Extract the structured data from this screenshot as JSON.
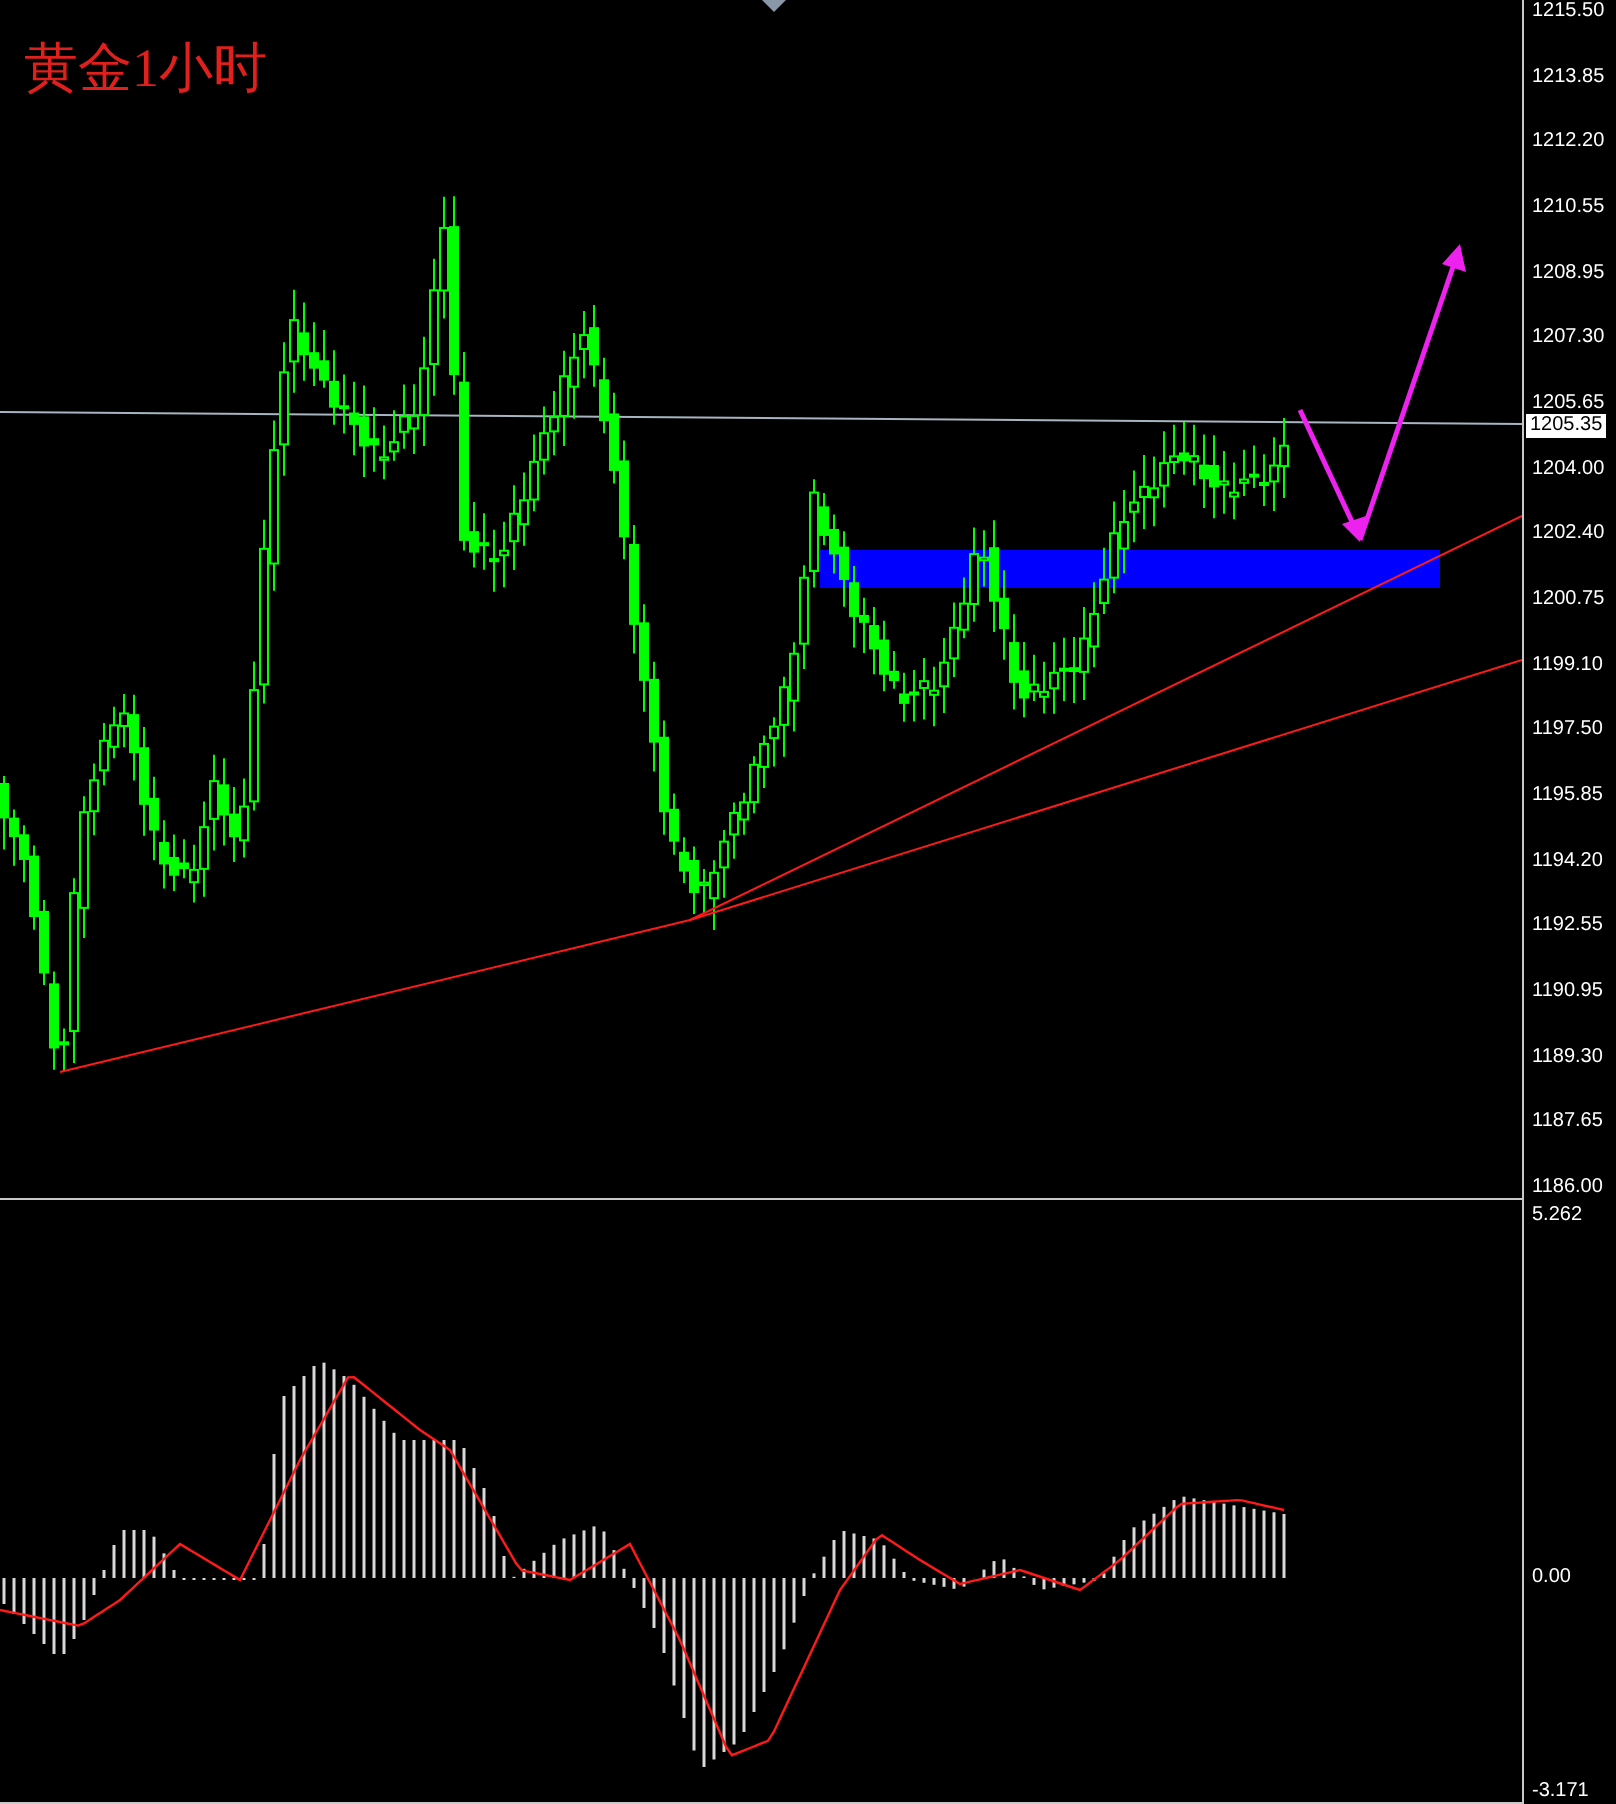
{
  "chart_title": "黄金1小时",
  "price_axis": {
    "labels": [
      "1215.50",
      "1213.85",
      "1212.20",
      "1210.55",
      "1208.95",
      "1207.30",
      "1205.65",
      "1204.00",
      "1202.40",
      "1200.75",
      "1199.10",
      "1197.50",
      "1195.85",
      "1194.20",
      "1192.55",
      "1190.95",
      "1189.30",
      "1187.65",
      "1186.00"
    ],
    "current_price": "1205.35"
  },
  "macd_axis": {
    "labels": [
      "5.262",
      "0.00",
      "-3.171"
    ]
  }
}
